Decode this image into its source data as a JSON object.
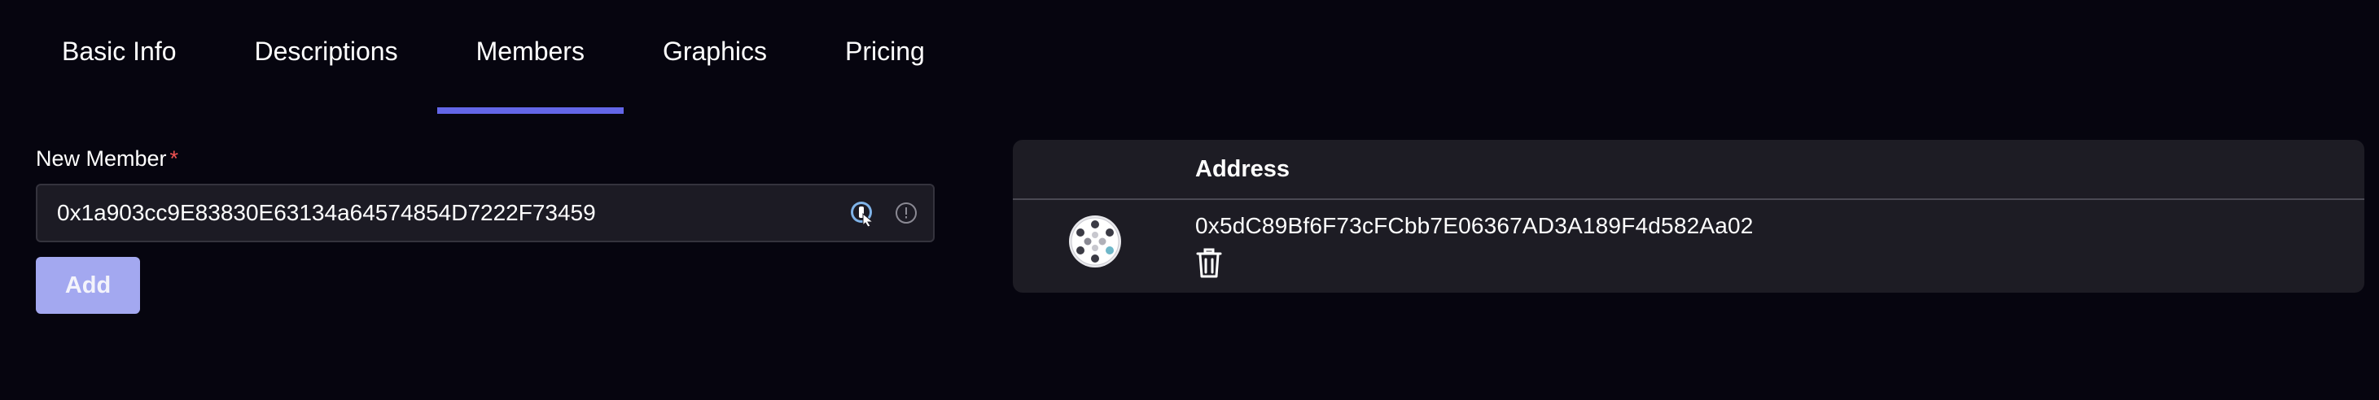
{
  "tabs": [
    {
      "label": "Basic Info",
      "active": false
    },
    {
      "label": "Descriptions",
      "active": false
    },
    {
      "label": "Members",
      "active": true
    },
    {
      "label": "Graphics",
      "active": false
    },
    {
      "label": "Pricing",
      "active": false
    }
  ],
  "form": {
    "label": "New Member",
    "required_mark": "*",
    "input_value": "0x1a903cc9E83830E63134a64574854D7222F73459",
    "add_label": "Add"
  },
  "table": {
    "header_address": "Address",
    "rows": [
      {
        "address": "0x5dC89Bf6F73cFCbb7E06367AD3A189F4d582Aa02",
        "avatar_icon": "identicon-avatar",
        "delete_icon": "trash-icon"
      }
    ]
  },
  "colors": {
    "background": "#06050f",
    "accent": "#6366e8",
    "card": "#1d1c24",
    "button": "#a3a8f0",
    "required": "#f05252"
  }
}
